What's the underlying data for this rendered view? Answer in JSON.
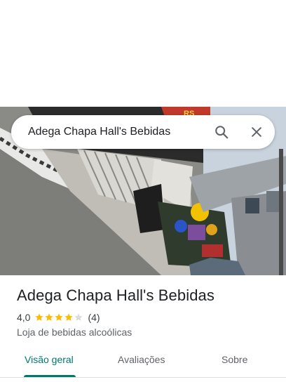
{
  "search": {
    "query": "Adega Chapa Hall's Bebidas"
  },
  "icons": {
    "search": "search-icon",
    "close": "close-icon",
    "star": "star-icon"
  },
  "place": {
    "name": "Adega Chapa Hall's Bebidas",
    "rating": "4,0",
    "stars": 4,
    "max_stars": 5,
    "reviews": "(4)",
    "category": "Loja de bebidas alcoólicas"
  },
  "tabs": [
    {
      "label": "Visão geral",
      "active": true
    },
    {
      "label": "Avaliações",
      "active": false
    },
    {
      "label": "Sobre",
      "active": false
    }
  ],
  "colors": {
    "accent": "#00796b",
    "star": "#fbbc04",
    "star_empty": "#dadce0"
  }
}
